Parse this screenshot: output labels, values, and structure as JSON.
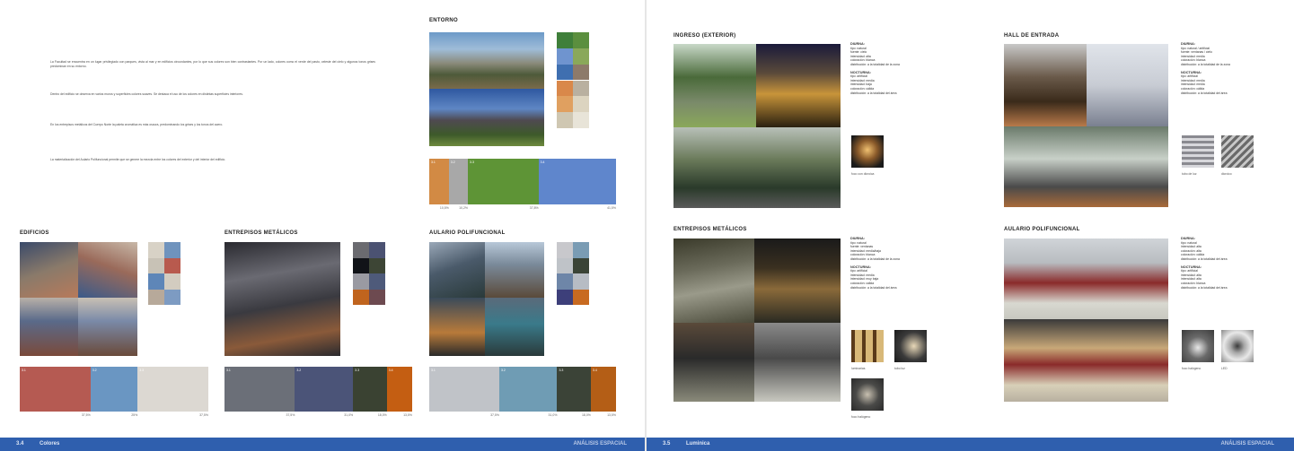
{
  "left_page": {
    "footer": {
      "number": "3.4",
      "name": "Colores",
      "right": "ANÁLISIS ESPACIAL"
    },
    "intro_paragraphs": [
      "La Facultad se encuentra en un lugar privilegiado con parques, vista al mar y en edificios circundantes, por lo que sus colores son bien contrastantes. Por un lado, colores como el verde del pasto, celeste del cielo y algunos tonos grises predominan en su entorno.",
      "Dentro del edificio se observa en varios muros y superficies colores suaves. Se destaca el uso de los colores en distintas superficies interiores.",
      "En los entrepisos metálicos del Cuerpo Norte la paleta cromática es más oscura, predominando los grises y los tonos del acero.",
      "La materialización del Aulario Polifuncional permite que se genere la mezcla entre los colores del exterior y del interior del edificio."
    ],
    "sections": {
      "entorno": {
        "title": "ENTORNO",
        "swatches": [
          "#3f7f3a",
          "#5b8f3e",
          "#6f94cf",
          "#8aa85a",
          "#3f6fb0",
          "#8d7a6a",
          "#d9884a",
          "#b9b0a0",
          "#e0a060",
          "#dcd4c0",
          "#cfc7b2",
          "#e8e4d8"
        ]
      },
      "edificios": {
        "title": "EDIFICIOS",
        "swatches": [
          "#d8d2c6",
          "#6f93bd",
          "#c8c2b6",
          "#b85a4e",
          "#5e86b8",
          "#d3ccc0",
          "#b7a99a",
          "#7d9bc2"
        ]
      },
      "entrepisos": {
        "title": "ENTREPISOS METÁLICOS",
        "swatches": [
          "#6b6b70",
          "#4b5272",
          "#111318",
          "#3d4535",
          "#9a9aa2",
          "#4e5a7a",
          "#c0641e",
          "#6d4a50"
        ]
      },
      "aulario": {
        "title": "AULARIO POLIFUNCIONAL",
        "swatches": [
          "#c8c8cc",
          "#7a9cb4",
          "#bfc3c8",
          "#3b4437",
          "#6e86a8",
          "#b7bcc4",
          "#3d3f7a",
          "#c86a20"
        ]
      }
    },
    "bars": {
      "entorno": [
        {
          "label": "3.1",
          "value": 10.5,
          "color": "#d28a44"
        },
        {
          "label": "3.2",
          "value": 10.2,
          "color": "#a8a8a8"
        },
        {
          "label": "3.3",
          "value": 37.8,
          "color": "#5e9436"
        },
        {
          "label": "3.4",
          "value": 41.5,
          "color": "#5f86cc"
        }
      ],
      "edificios": [
        {
          "label": "3.1",
          "value": 37.5,
          "color": "#b55a52"
        },
        {
          "label": "3.2",
          "value": 25,
          "color": "#6a96c2"
        },
        {
          "label": "3.3",
          "value": 37.5,
          "color": "#dcd8d2"
        }
      ],
      "entrepisos": [
        {
          "label": "3.1",
          "value": 37.5,
          "color": "#6b6f78"
        },
        {
          "label": "3.2",
          "value": 31,
          "color": "#4b5478"
        },
        {
          "label": "3.3",
          "value": 18,
          "color": "#3a4232"
        },
        {
          "label": "3.4",
          "value": 13.5,
          "color": "#c45e12"
        }
      ],
      "aulario": [
        {
          "label": "3.1",
          "value": 37.5,
          "color": "#c0c3c8"
        },
        {
          "label": "3.2",
          "value": 31,
          "color": "#6f9cb4"
        },
        {
          "label": "3.3",
          "value": 18,
          "color": "#3b4337"
        },
        {
          "label": "3.4",
          "value": 13.5,
          "color": "#b45e16"
        }
      ]
    },
    "bar_pcts": {
      "entorno": [
        "10,5%",
        "10,2%",
        "37,8%",
        "41,5%"
      ],
      "edificios": [
        "37,5%",
        "25%",
        "37,5%"
      ],
      "entrepisos": [
        "37,5%",
        "31,0%",
        "18,0%",
        "13,5%"
      ],
      "aulario": [
        "37,5%",
        "31,0%",
        "18,0%",
        "13,5%"
      ]
    }
  },
  "right_page": {
    "footer": {
      "number": "3.5",
      "name": "Luminica",
      "right": "ANÁLISIS ESPACIAL"
    },
    "sections": {
      "ingreso": {
        "title": "INGRESO (EXTERIOR)",
        "dia_title": "DIURNA:",
        "dia": [
          "tipo: natural",
          "fuente: cielo",
          "intensidad: alta",
          "coloración: blanca",
          "distribución: a la totalidad de la zona"
        ],
        "noc_title": "NOCTURNA:",
        "noc": [
          "tipo: artificial",
          "intensidad: media",
          "intensidad: baja",
          "coloración: cálida",
          "distribución: a la totalidad del área"
        ],
        "caps": [
          "foco con dicroica"
        ]
      },
      "hall": {
        "title": "HALL DE ENTRADA",
        "dia_title": "DIURNA:",
        "dia": [
          "tipo: natural / artificial",
          "fuente: ventanas / cielo",
          "intensidad: media",
          "coloración: blanca",
          "distribución: a la totalidad de la zona"
        ],
        "noc_title": "NOCTURNA:",
        "noc": [
          "tipo: artificial",
          "intensidad: media",
          "intensidad: media",
          "coloración: cálida",
          "distribución: a la totalidad del área"
        ],
        "caps": [
          "tubo de luz",
          "dicroico"
        ]
      },
      "entrepisos": {
        "title": "ENTREPISOS METÁLICOS",
        "dia_title": "DIURNA:",
        "dia": [
          "tipo: natural",
          "fuente: ventanas",
          "intensidad: media/baja",
          "coloración: blanca",
          "distribución: a la totalidad de la zona"
        ],
        "noc_title": "NOCTURNA:",
        "noc": [
          "tipo: artificial",
          "intensidad: media",
          "intensidad: muy baja",
          "coloración: cálida",
          "distribución: a la totalidad del área"
        ],
        "caps": [
          "luminarias",
          "tubo luz",
          "foco halógeno"
        ]
      },
      "aulario": {
        "title": "AULARIO POLIFUNCIONAL",
        "dia_title": "DIURNA:",
        "dia": [
          "tipo: natural",
          "intensidad: alta",
          "coloración: alta",
          "coloración: cálida",
          "distribución: a la totalidad del área"
        ],
        "noc_title": "NOCTURNA:",
        "noc": [
          "tipo: artificial",
          "intensidad: alta",
          "intensidad: alta",
          "coloración: blanca",
          "distribución: a la totalidad del área"
        ],
        "caps": [
          "foco halógeno",
          "LED"
        ]
      }
    }
  }
}
